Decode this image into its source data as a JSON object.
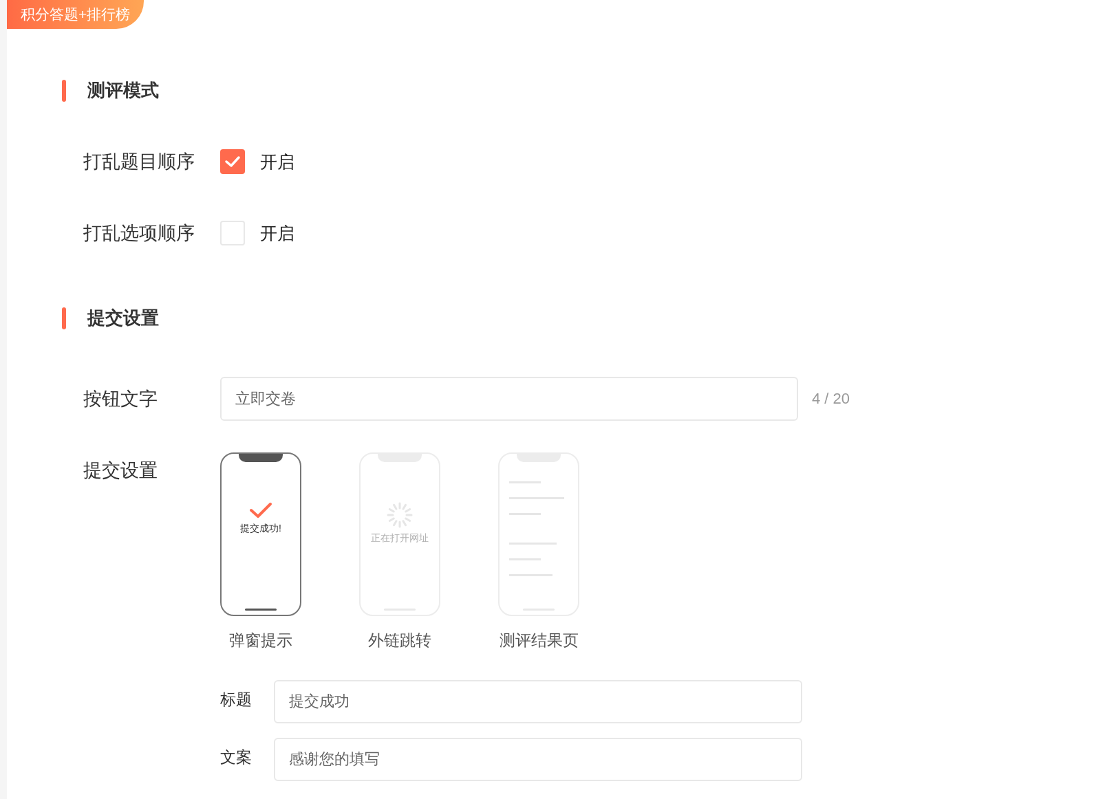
{
  "badge": "积分答题+排行榜",
  "sections": [
    {
      "title": "测评模式",
      "rows": [
        {
          "kind": "checkbox",
          "label": "打乱题目顺序",
          "checked": true,
          "option": "开启"
        },
        {
          "kind": "checkbox",
          "label": "打乱选项顺序",
          "checked": false,
          "option": "开启"
        }
      ]
    },
    {
      "title": "提交设置",
      "rows": [
        {
          "kind": "text",
          "label": "按钮文字",
          "value": "立即交卷",
          "counter": "4 / 20"
        },
        {
          "kind": "choices",
          "label": "提交设置",
          "options": [
            {
              "kind": "popup",
              "label": "弹窗提示",
              "selected": true,
              "screen_text": "提交成功!"
            },
            {
              "kind": "link",
              "label": "外链跳转",
              "selected": false,
              "screen_text": "正在打开网址"
            },
            {
              "kind": "result",
              "label": "测评结果页",
              "selected": false
            }
          ],
          "fields": [
            {
              "label": "标题",
              "value": "提交成功"
            },
            {
              "label": "文案",
              "value": "感谢您的填写"
            }
          ]
        }
      ]
    }
  ]
}
